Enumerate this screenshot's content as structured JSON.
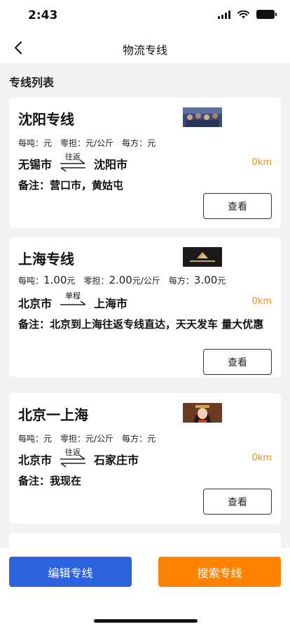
{
  "status": {
    "time": "2:43"
  },
  "nav": {
    "title": "物流专线"
  },
  "section_title": "专线列表",
  "cards": [
    {
      "title": "沈阳专线",
      "thumb": "crowd-photo",
      "price_ton_label": "每吨：",
      "price_ton": "元",
      "price_piece_label": "零担：",
      "price_piece": "元/公斤",
      "price_cubic_label": "每方：",
      "price_cubic": "元",
      "from": "无锡市",
      "direction": "往返",
      "to": "沈阳市",
      "distance": "0km",
      "note": "备注：营口市，黄姑屯",
      "view_label": "查看"
    },
    {
      "title": "上海专线",
      "thumb": "logo-dark",
      "price_ton_label": "每吨：",
      "price_ton": "1.00",
      "price_ton_unit": "元",
      "price_piece_label": "零担：",
      "price_piece": "2.00",
      "price_piece_unit": "元/公斤",
      "price_cubic_label": "每方：",
      "price_cubic": "3.00",
      "price_cubic_unit": "元",
      "from": "北京市",
      "direction": "单程",
      "to": "上海市",
      "distance": "0km",
      "note": "备注：北京到上海往返专线直达，天天发车 量大优惠",
      "view_label": "查看"
    },
    {
      "title": "北京一上海",
      "thumb": "portrait-photo",
      "price_ton_label": "每吨：",
      "price_ton": "元",
      "price_piece_label": "零担：",
      "price_piece": "元/公斤",
      "price_cubic_label": "每方：",
      "price_cubic": "元",
      "from": "北京市",
      "direction": "往返",
      "to": "石家庄市",
      "distance": "0km",
      "note": "备注：我现在",
      "view_label": "查看"
    }
  ],
  "bottom": {
    "edit_label": "编辑专线",
    "search_label": "搜索专线"
  },
  "colors": {
    "primary": "#2c62de",
    "accent": "#ff8200",
    "distance": "#ff8a00"
  }
}
